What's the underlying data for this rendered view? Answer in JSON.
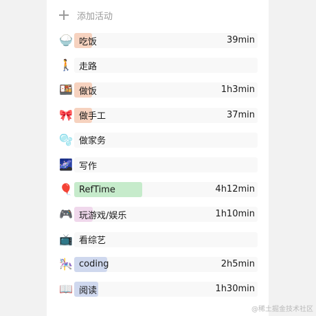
{
  "add_activity": {
    "label": "添加活动",
    "icon": "plus-icon"
  },
  "activities": [
    {
      "icon": "🍚",
      "icon_name": "rice-icon",
      "label": "吃饭",
      "duration": "39min",
      "level": 0.05,
      "color": "#f6d2bf"
    },
    {
      "icon": "🚶",
      "icon_name": "walking-icon",
      "label": "走路",
      "duration": "",
      "level": 0,
      "color": "#f6d2bf"
    },
    {
      "icon": "🍱",
      "icon_name": "bento-icon",
      "label": "做饭",
      "duration": "1h3min",
      "level": 0.09,
      "color": "#f6d2bf"
    },
    {
      "icon": "🎀",
      "icon_name": "ribbon-icon",
      "label": "做手工",
      "duration": "37min",
      "level": 0.05,
      "color": "#f6d2bf"
    },
    {
      "icon": "🫧",
      "icon_name": "bubbles-icon",
      "label": "做家务",
      "duration": "",
      "level": 0,
      "color": "#dfe8f6"
    },
    {
      "icon": "🌌",
      "icon_name": "night-sky-icon",
      "label": "写作",
      "duration": "",
      "level": 0,
      "color": "#dfe8f6"
    },
    {
      "icon": "🎈",
      "icon_name": "balloon-icon",
      "label": "RefTime",
      "duration": "4h12min",
      "level": 0.37,
      "color": "#c6ebcb"
    },
    {
      "icon": "🎮",
      "icon_name": "gamepad-icon",
      "label": "玩游戏/娱乐",
      "duration": "1h10min",
      "level": 0.1,
      "color": "#f0d8ec"
    },
    {
      "icon": "📺",
      "icon_name": "tv-icon",
      "label": "看综艺",
      "duration": "",
      "level": 0,
      "color": "#e3e8f3"
    },
    {
      "icon": "🎠",
      "icon_name": "carousel-icon",
      "label": "coding",
      "duration": "2h5min",
      "level": 0.18,
      "color": "#cfd8ee"
    },
    {
      "icon": "📖",
      "icon_name": "book-icon",
      "label": "阅读",
      "duration": "1h30min",
      "level": 0.13,
      "color": "#cfd8ee"
    }
  ],
  "watermark": "@稀土掘金技术社区"
}
